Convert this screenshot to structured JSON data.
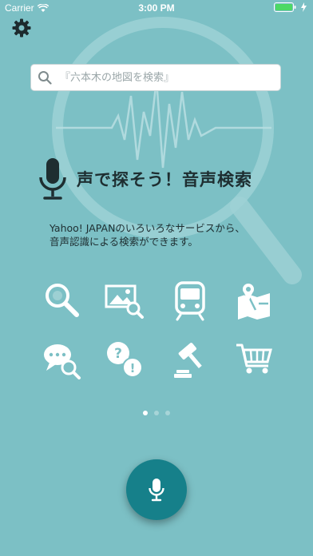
{
  "status_bar": {
    "carrier": "Carrier",
    "time": "3:00 PM"
  },
  "search": {
    "placeholder": "『六本木の地図を検索』",
    "value": ""
  },
  "hero": {
    "title": "声で探そう！音声検索"
  },
  "description": {
    "line1": "Yahoo! JAPANのいろいろなサービスから、",
    "line2": "音声認識による検索ができます。"
  },
  "features": [
    {
      "icon": "magnifier-icon"
    },
    {
      "icon": "image-search-icon"
    },
    {
      "icon": "train-icon"
    },
    {
      "icon": "map-pin-icon"
    },
    {
      "icon": "chat-search-icon"
    },
    {
      "icon": "question-answer-icon"
    },
    {
      "icon": "auction-gavel-icon"
    },
    {
      "icon": "shopping-cart-icon"
    }
  ],
  "pagination": {
    "current": 1,
    "total": 3
  },
  "colors": {
    "background": "#7cc0c5",
    "mic_button": "#16808a",
    "icon": "#ffffff",
    "text": "#1e2e31"
  }
}
